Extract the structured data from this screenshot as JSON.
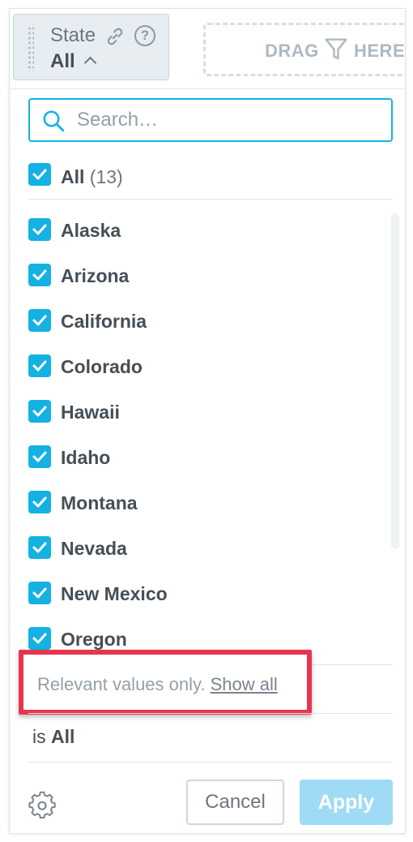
{
  "filter": {
    "title": "State",
    "value": "All",
    "icons": [
      "drag-grip-icon",
      "link-icon",
      "help-icon",
      "chevron-up-icon"
    ]
  },
  "drop_zone": {
    "before": "DRAG",
    "after": "HERE",
    "icon": "funnel-icon"
  },
  "search": {
    "placeholder": "Search…",
    "value": ""
  },
  "select_all": {
    "label": "All",
    "count": "(13)",
    "checked": true
  },
  "items": [
    {
      "label": "Alaska",
      "checked": true
    },
    {
      "label": "Arizona",
      "checked": true
    },
    {
      "label": "California",
      "checked": true
    },
    {
      "label": "Colorado",
      "checked": true
    },
    {
      "label": "Hawaii",
      "checked": true
    },
    {
      "label": "Idaho",
      "checked": true
    },
    {
      "label": "Montana",
      "checked": true
    },
    {
      "label": "Nevada",
      "checked": true
    },
    {
      "label": "New Mexico",
      "checked": true
    },
    {
      "label": "Oregon",
      "checked": true
    }
  ],
  "notice": {
    "text": "Relevant values only. ",
    "link": "Show all"
  },
  "summary": {
    "prefix": "is ",
    "value": "All"
  },
  "footer": {
    "cancel_label": "Cancel",
    "apply_label": "Apply"
  },
  "colors": {
    "accent": "#14b2e2",
    "highlight": "#e8354e",
    "apply_disabled": "#9fdbf4"
  }
}
